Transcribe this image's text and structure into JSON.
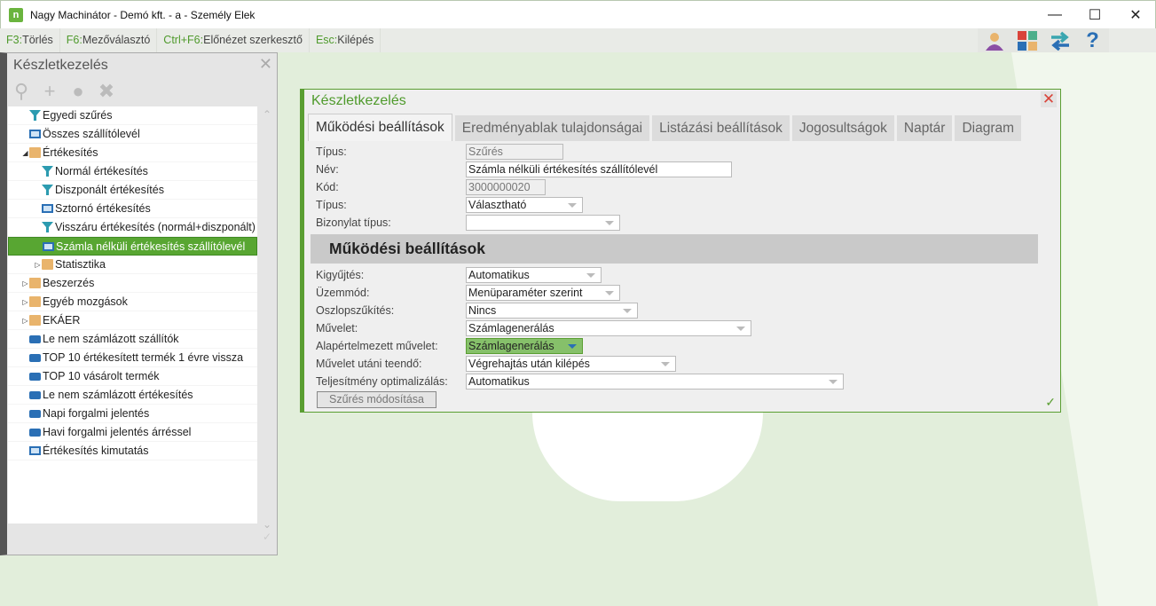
{
  "window": {
    "title": "Nagy Machinátor - Demó kft. - a - Személy Elek",
    "logo": "n",
    "minimize": "—",
    "maximize": "☐",
    "close": "✕"
  },
  "toolbar": {
    "hotkeys": [
      {
        "key": "F3:",
        "label": "Törlés"
      },
      {
        "key": "F6:",
        "label": "Mezőválasztó"
      },
      {
        "key": "Ctrl+F6:",
        "label": "Előnézet szerkesztő"
      },
      {
        "key": "Esc:",
        "label": "Kilépés"
      }
    ]
  },
  "left_panel": {
    "title": "Készletkezelés",
    "close": "✕",
    "tools": [
      "search-icon",
      "add-icon",
      "tree-icon",
      "unpin-icon"
    ],
    "items": [
      {
        "label": "Egyedi szűrés",
        "icon": "filter",
        "level": 0
      },
      {
        "label": "Összes szállítólevél",
        "icon": "monitor",
        "level": 0
      },
      {
        "label": "Értékesítés",
        "icon": "folder",
        "level": 0,
        "expanded": true
      },
      {
        "label": "Normál értékesítés",
        "icon": "filter",
        "level": 1
      },
      {
        "label": "Diszponált értékesítés",
        "icon": "filter",
        "level": 1
      },
      {
        "label": "Sztornó értékesítés",
        "icon": "monitor",
        "level": 1
      },
      {
        "label": "Visszáru értékesítés (normál+diszponált)",
        "icon": "filter",
        "level": 1
      },
      {
        "label": "Számla nélküli értékesítés szállítólevél",
        "icon": "monitor",
        "level": 1,
        "selected": true
      },
      {
        "label": "Statisztika",
        "icon": "folder",
        "level": 1,
        "collapsed": true
      },
      {
        "label": "Beszerzés",
        "icon": "folder",
        "level": 0,
        "collapsed": true
      },
      {
        "label": "Egyéb mozgások",
        "icon": "folder",
        "level": 0,
        "collapsed": true
      },
      {
        "label": "EKÁER",
        "icon": "folder",
        "level": 0,
        "collapsed": true
      },
      {
        "label": "Le nem számlázott szállítók",
        "icon": "print",
        "level": 0
      },
      {
        "label": "TOP 10 értékesített termék 1 évre vissza",
        "icon": "print",
        "level": 0
      },
      {
        "label": "TOP 10 vásárolt termék",
        "icon": "print",
        "level": 0
      },
      {
        "label": "Le nem számlázott értékesítés",
        "icon": "print",
        "level": 0
      },
      {
        "label": "Napi forgalmi jelentés",
        "icon": "print",
        "level": 0
      },
      {
        "label": "Havi forgalmi jelentés árréssel",
        "icon": "print",
        "level": 0
      },
      {
        "label": "Értékesítés kimutatás",
        "icon": "monitor",
        "level": 0
      }
    ]
  },
  "dialog": {
    "title": "Készletkezelés",
    "close": "✕",
    "check": "✓",
    "tabs": [
      "Működési beállítások",
      "Eredményablak tulajdonságai",
      "Listázási beállítások",
      "Jogosultságok",
      "Naptár",
      "Diagram"
    ],
    "fields_top": [
      {
        "label": "Típus:",
        "value": "Szűrés",
        "readonly": true
      },
      {
        "label": "Név:",
        "value": "Számla nélküli értékesítés szállítólevél"
      },
      {
        "label": "Kód:",
        "value": "3000000020",
        "readonly": true
      },
      {
        "label": "Típus:",
        "value": "Választható",
        "dropdown": true
      },
      {
        "label": "Bizonylat típus:",
        "value": "",
        "dropdown": true
      }
    ],
    "section_title": "Működési beállítások",
    "fields": [
      {
        "label": "Kigyűjtés:",
        "value": "Automatikus"
      },
      {
        "label": "Üzemmód:",
        "value": "Menüparaméter szerint"
      },
      {
        "label": "Oszlopszűkítés:",
        "value": "Nincs"
      },
      {
        "label": "Művelet:",
        "value": "Számlagenerálás"
      },
      {
        "label": "Alapértelmezett művelet:",
        "value": "Számlagenerálás",
        "focused": true
      },
      {
        "label": "Művelet utáni teendő:",
        "value": "Végrehajtás után kilépés"
      },
      {
        "label": "Teljesítmény optimalizálás:",
        "value": "Automatikus"
      }
    ],
    "modify_button": "Szűrés módosítása"
  },
  "colors": {
    "accent": "#5a9e32",
    "selected": "#58a632",
    "background": "#e2eedb"
  }
}
